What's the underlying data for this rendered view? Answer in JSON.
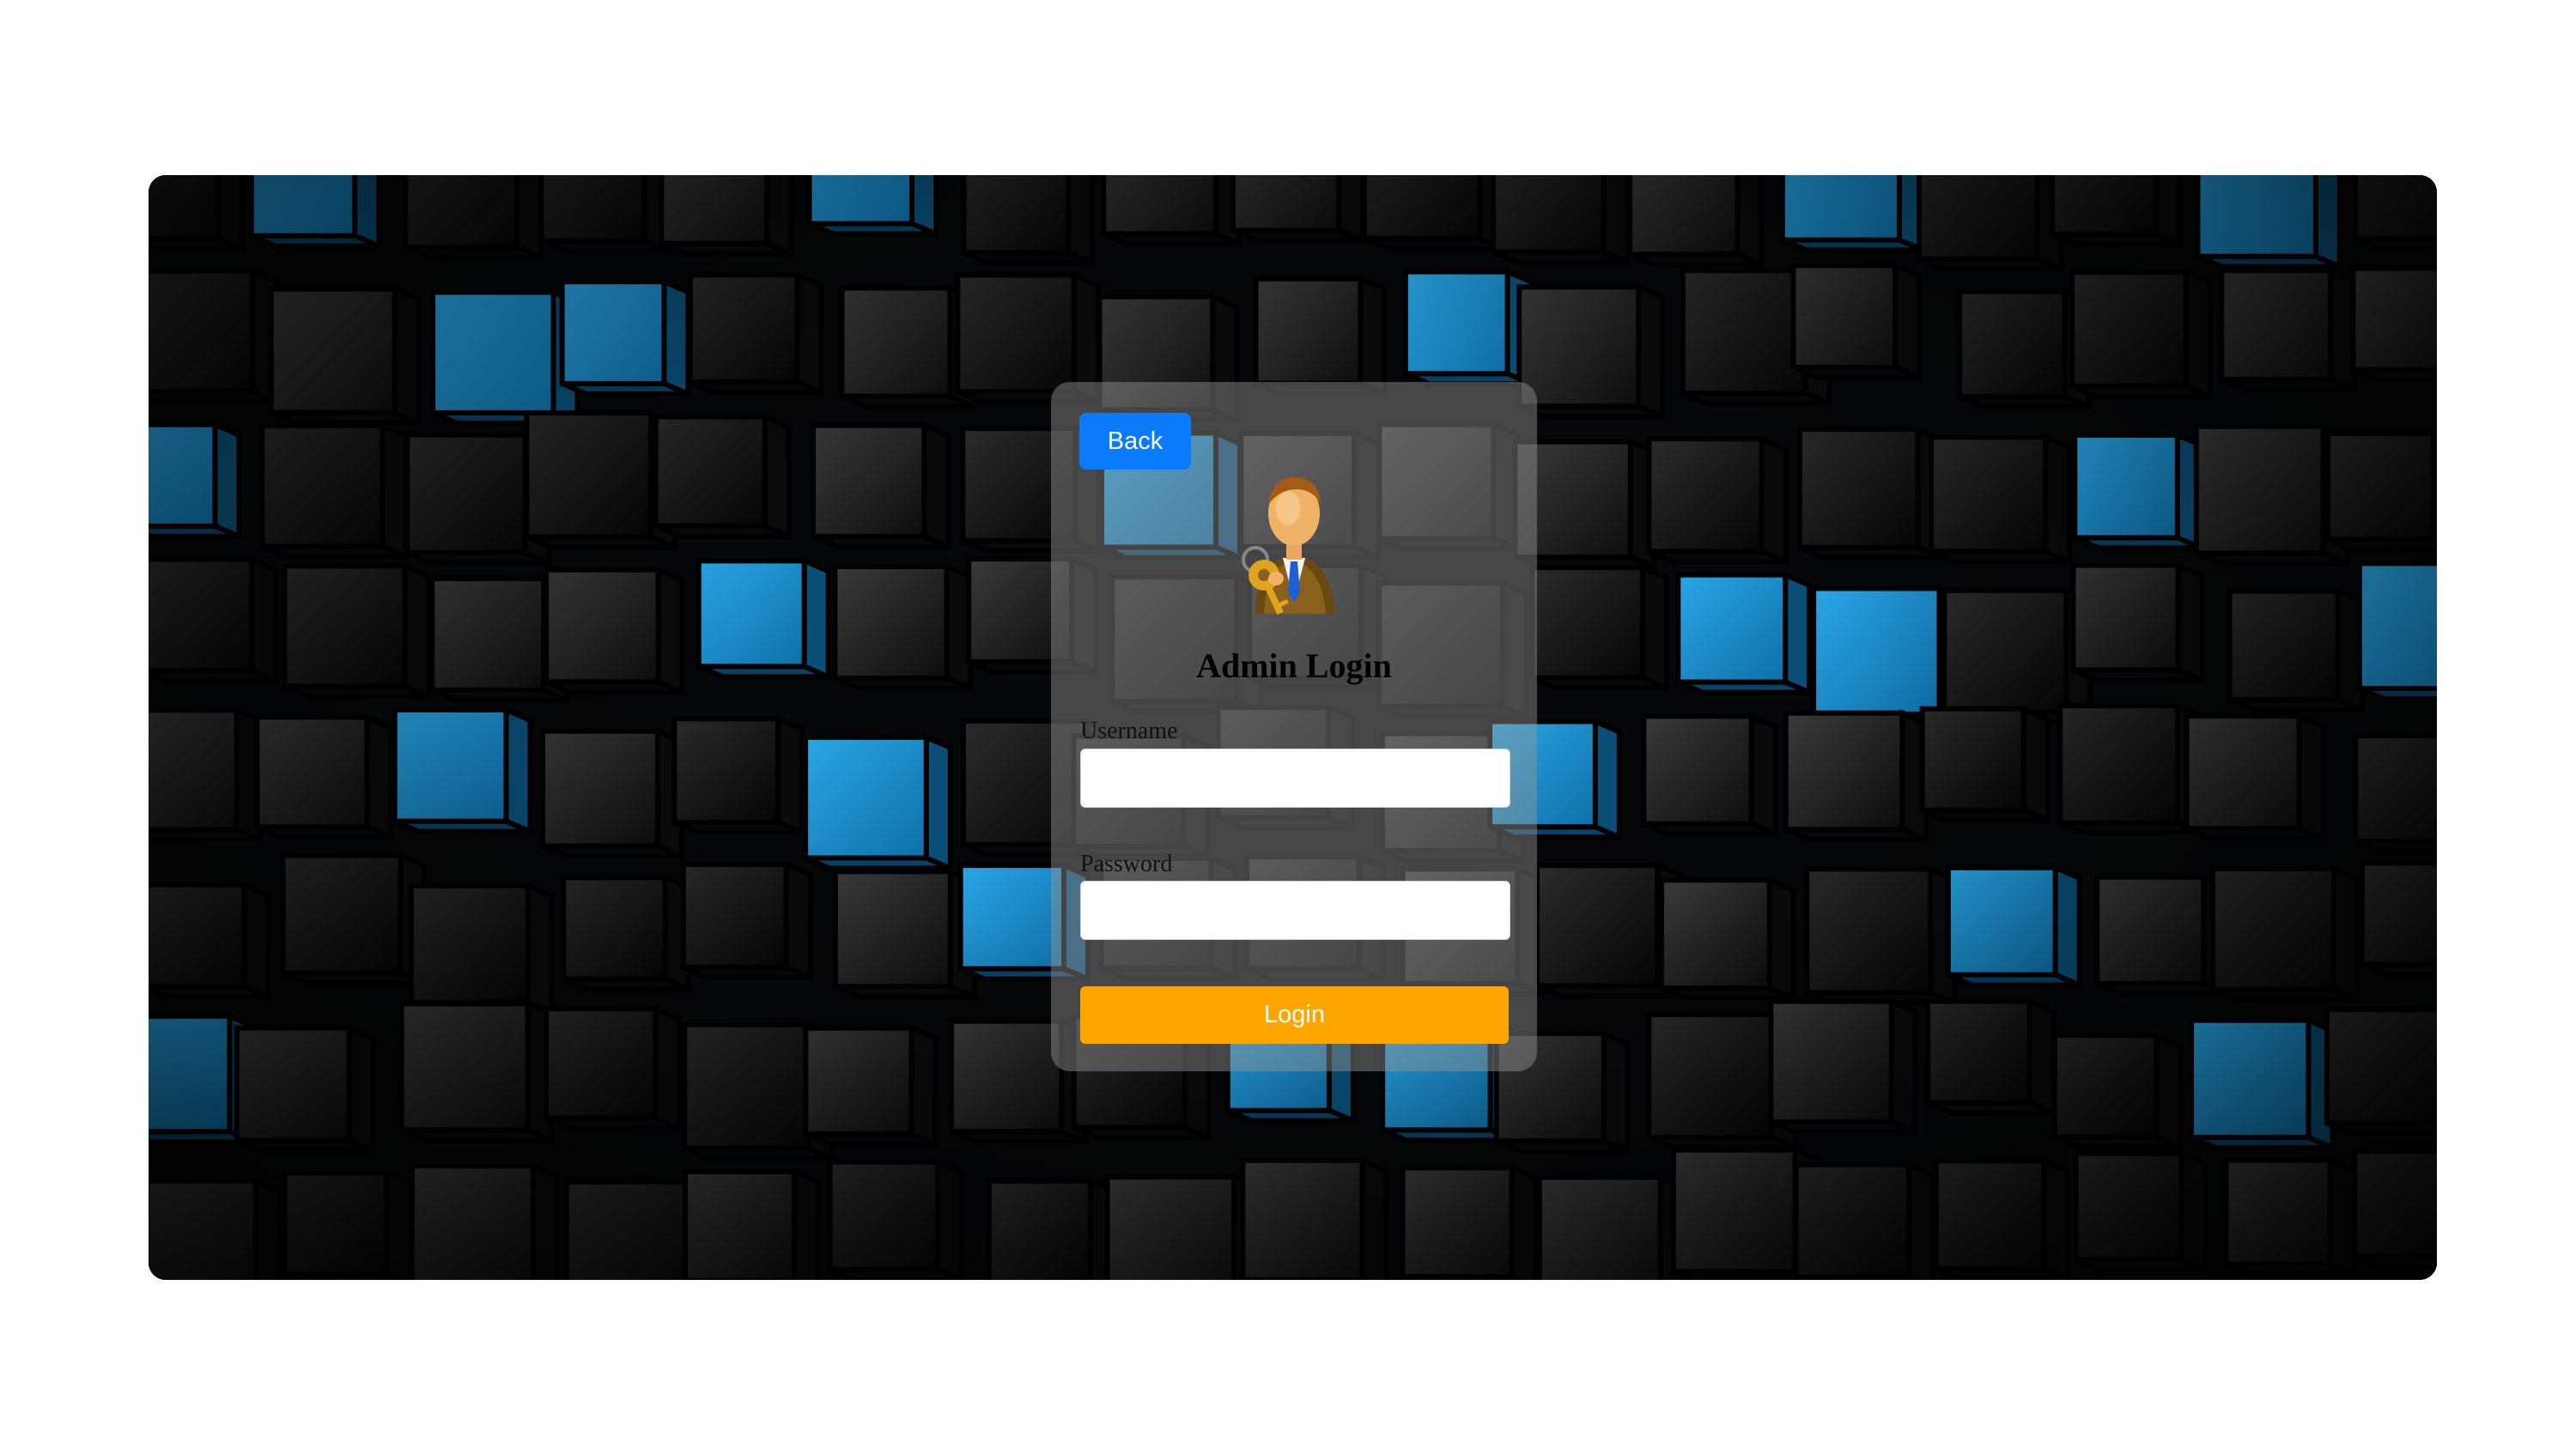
{
  "page": {
    "background_color": "#ffffff",
    "hero_background": "dark 3D cubes with blue accent cubes"
  },
  "login_card": {
    "back_label": "Back",
    "avatar_icon": "admin-with-key-icon",
    "title": "Admin Login",
    "username_label": "Username",
    "username_value": "",
    "password_label": "Password",
    "password_value": "",
    "login_label": "Login"
  },
  "colors": {
    "back_button": "#0a7bff",
    "login_button": "#ffa500",
    "accent_cube": "#1d8fcf",
    "dark_cube": "#1c1c1c"
  }
}
